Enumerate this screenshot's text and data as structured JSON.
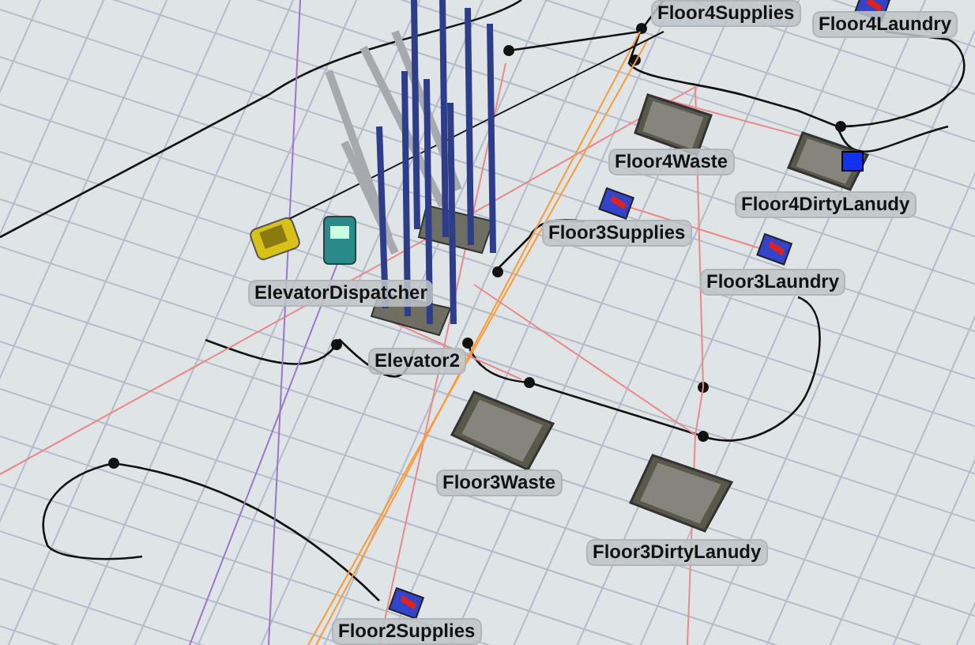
{
  "scene": {
    "objects": [
      {
        "kind": "label",
        "label": "Floor4Supplies"
      },
      {
        "kind": "source",
        "label": "Floor4Laundry"
      },
      {
        "kind": "queue",
        "label": "Floor4Waste",
        "has_item": false
      },
      {
        "kind": "queue",
        "label": "Floor4DirtyLanudy",
        "has_item": true
      },
      {
        "kind": "source",
        "label": "Floor3Supplies"
      },
      {
        "kind": "dispatcher",
        "label": "ElevatorDispatcher"
      },
      {
        "kind": "source",
        "label": "Floor3Laundry"
      },
      {
        "kind": "elevator",
        "label": "Elevator2"
      },
      {
        "kind": "queue",
        "label": "Floor3Waste",
        "has_item": false
      },
      {
        "kind": "queue",
        "label": "Floor3DirtyLanudy",
        "has_item": false
      },
      {
        "kind": "source",
        "label": "Floor2Supplies"
      }
    ]
  }
}
